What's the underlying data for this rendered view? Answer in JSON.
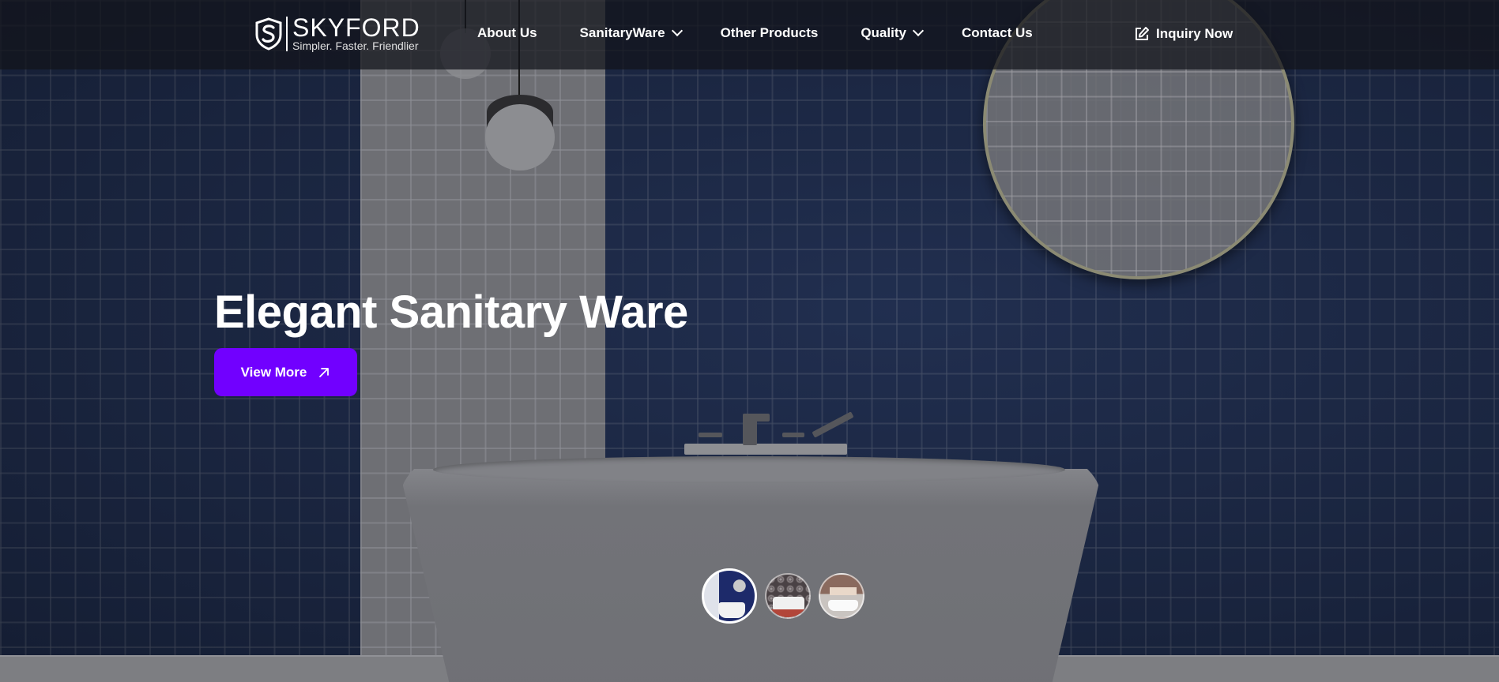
{
  "brand": {
    "name": "SKYFORD",
    "tagline": "Simpler. Faster. Friendlier"
  },
  "nav": {
    "items": [
      {
        "label": "About Us",
        "has_dropdown": false
      },
      {
        "label": "SanitaryWare",
        "has_dropdown": true
      },
      {
        "label": "Other Products",
        "has_dropdown": false
      },
      {
        "label": "Quality",
        "has_dropdown": true
      },
      {
        "label": "Contact Us",
        "has_dropdown": false
      }
    ],
    "inquiry_label": "Inquiry Now",
    "inquiry_icon": "edit-icon"
  },
  "hero": {
    "headline": "Elegant Sanitary Ware",
    "cta_label": "View More",
    "cta_icon": "arrow-up-right-icon",
    "slides": [
      {
        "name": "slide-navy-bathroom",
        "active": true
      },
      {
        "name": "slide-floral-bathroom",
        "active": false
      },
      {
        "name": "slide-brown-bathroom",
        "active": false
      }
    ]
  },
  "colors": {
    "accent": "#7100ff",
    "navbar_bg": "#12141a",
    "tile_navy": "#1d2a47"
  }
}
